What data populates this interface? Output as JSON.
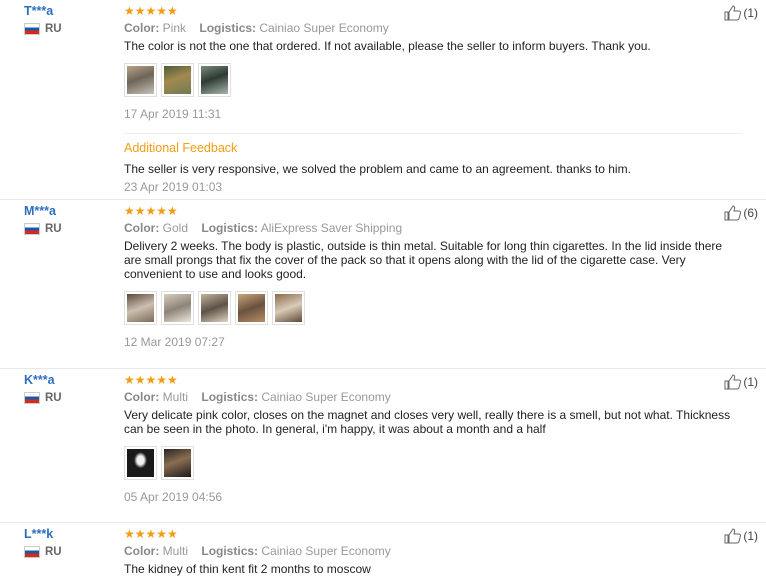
{
  "reviews": [
    {
      "user": "T***a",
      "country": "RU",
      "stars": "★★★★★",
      "color_label": "Color:",
      "color": "Pink",
      "logistics_label": "Logistics:",
      "logistics": "Cainiao Super Economy",
      "text": "The color is not the one that ordered. If not available, please the seller to inform buyers. Thank you.",
      "date": "17 Apr 2019 11:31",
      "helpful": "(1)",
      "additional_title": "Additional Feedback",
      "additional_text": "The seller is very responsive, we solved the problem and came to an agreement. thanks to him.",
      "additional_date": "23 Apr 2019 01:03"
    },
    {
      "user": "M***a",
      "country": "RU",
      "stars": "★★★★★",
      "color_label": "Color:",
      "color": "Gold",
      "logistics_label": "Logistics:",
      "logistics": "AliExpress Saver Shipping",
      "text": "Delivery 2 weeks. The body is plastic, outside is thin metal. Suitable for long thin cigarettes. In the lid inside there are small prongs that fix the cover of the pack so that it opens along with the lid of the cigarette case. Very convenient to use and looks good.",
      "date": "12 Mar 2019 07:27",
      "helpful": "(6)"
    },
    {
      "user": "K***a",
      "country": "RU",
      "stars": "★★★★★",
      "color_label": "Color:",
      "color": "Multi",
      "logistics_label": "Logistics:",
      "logistics": "Cainiao Super Economy",
      "text": "Very delicate pink color, closes on the magnet and closes very well, really there is a smell, but not what. Thickness can be seen in the photo. In general, i'm happy, it was about a month and a half",
      "date": "05 Apr 2019 04:56",
      "helpful": "(1)"
    },
    {
      "user": "L***k",
      "country": "RU",
      "stars": "★★★★★",
      "color_label": "Color:",
      "color": "Multi",
      "logistics_label": "Logistics:",
      "logistics": "Cainiao Super Economy",
      "text": "The kidney of thin kent fit 2 months to moscow",
      "helpful": "(1)"
    }
  ],
  "colors": {
    "accent": "#f39c12",
    "username": "#2c6ec1"
  },
  "icons": {
    "helpful": "thumbs-up-icon",
    "rating": "star-icon",
    "flag": "russia-flag-icon"
  }
}
